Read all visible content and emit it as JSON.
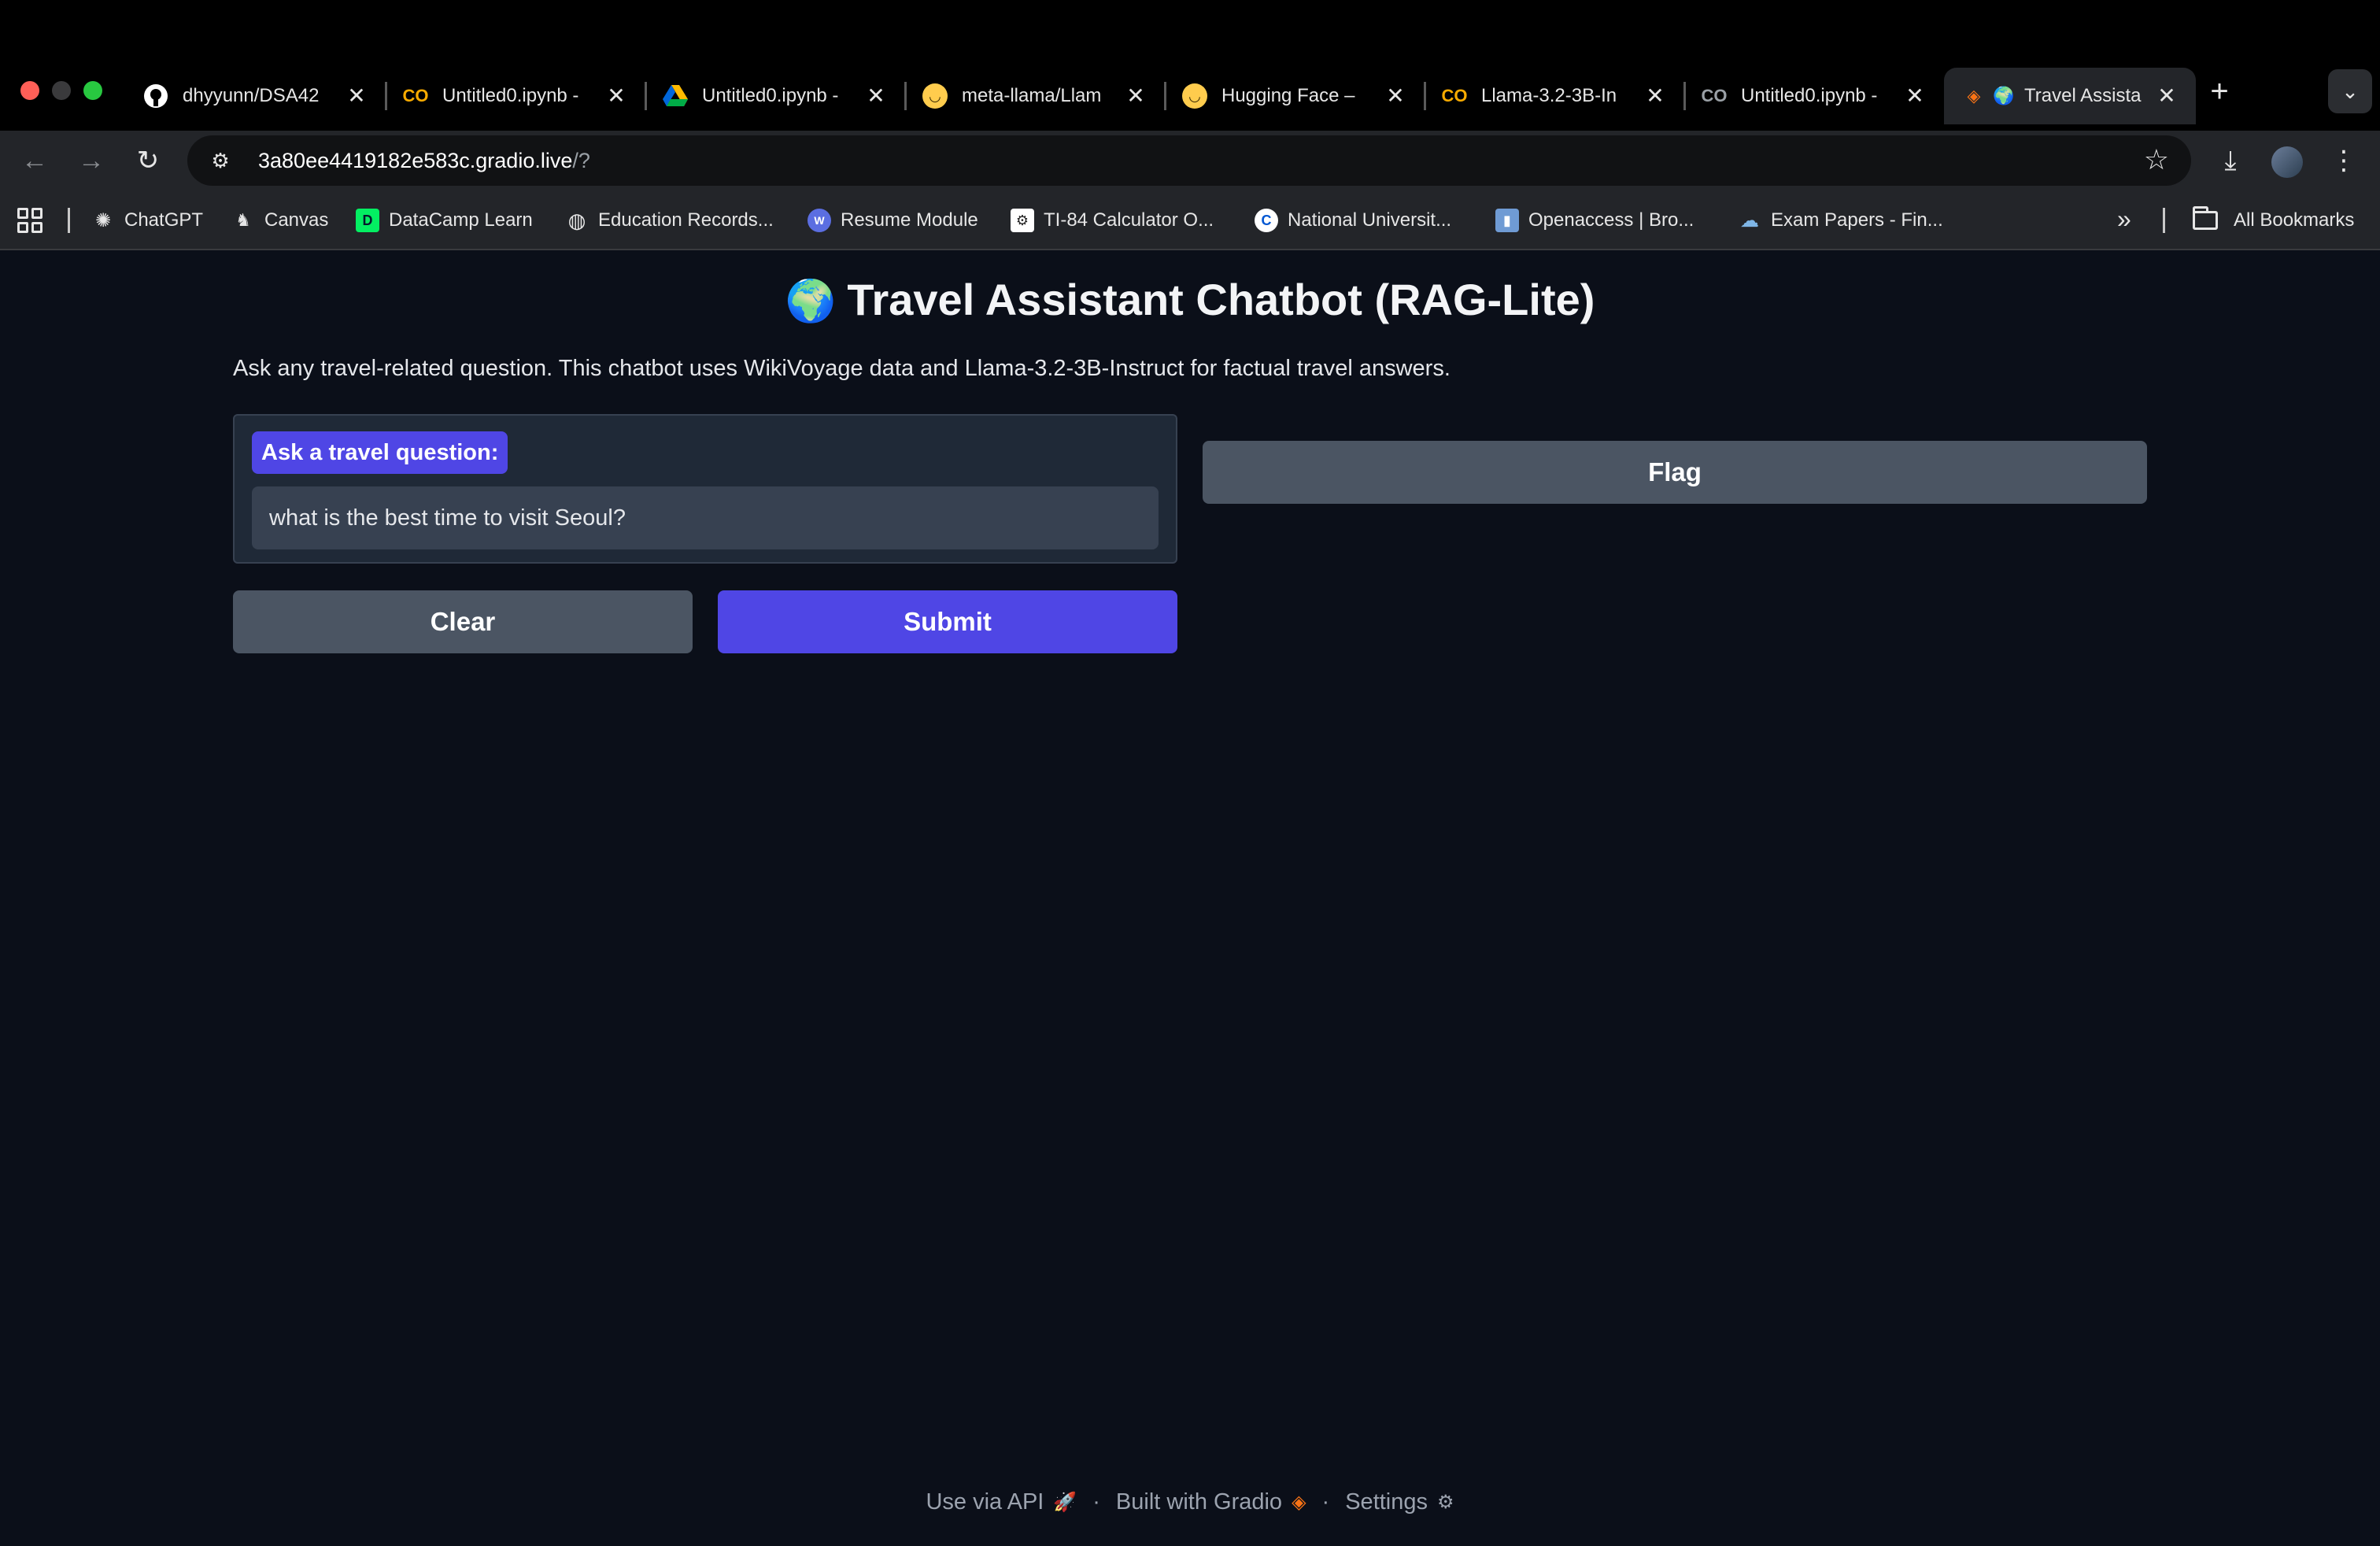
{
  "browser": {
    "tabs": [
      {
        "title": "dhyyunn/DSA42",
        "favicon": "github-icon",
        "active": false
      },
      {
        "title": "Untitled0.ipynb -",
        "favicon": "colab-icon",
        "active": false
      },
      {
        "title": "Untitled0.ipynb -",
        "favicon": "google-drive-icon",
        "active": false
      },
      {
        "title": "meta-llama/Llam",
        "favicon": "hugging-face-icon",
        "active": false
      },
      {
        "title": "Hugging Face –",
        "favicon": "hugging-face-icon",
        "active": false
      },
      {
        "title": "Llama-3.2-3B-In",
        "favicon": "colab-icon",
        "active": false
      },
      {
        "title": "Untitled0.ipynb -",
        "favicon": "colab-icon",
        "active": false
      },
      {
        "title": "Travel Assista",
        "favicon": "gradio-icon",
        "active": true
      }
    ],
    "url_host": "3a80ee4419182e583c.gradio.live",
    "url_path": "/?",
    "bookmarks": [
      {
        "label": "ChatGPT",
        "icon": "chatgpt-icon"
      },
      {
        "label": "Canvas",
        "icon": "canvas-icon"
      },
      {
        "label": "DataCamp Learn",
        "icon": "datacamp-icon"
      },
      {
        "label": "Education Records...",
        "icon": "globe-icon"
      },
      {
        "label": "Resume Module",
        "icon": "resume-icon"
      },
      {
        "label": "TI-84 Calculator O...",
        "icon": "calculator-icon"
      },
      {
        "label": "National Universit...",
        "icon": "coursera-icon"
      },
      {
        "label": "Openaccess | Bro...",
        "icon": "openaccess-icon"
      },
      {
        "label": "Exam Papers - Fin...",
        "icon": "cloud-icon"
      }
    ],
    "all_bookmarks_label": "All Bookmarks"
  },
  "app": {
    "title": "Travel Assistant Chatbot (RAG-Lite)",
    "title_emoji": "🌍",
    "description": "Ask any travel-related question. This chatbot uses WikiVoyage data and Llama-3.2-3B-Instruct for factual travel answers.",
    "input_label": "Ask a travel question:",
    "input_value": "what is the best time to visit Seoul?",
    "clear_label": "Clear",
    "submit_label": "Submit",
    "flag_label": "Flag"
  },
  "footer": {
    "api_label": "Use via API",
    "built_label": "Built with Gradio",
    "settings_label": "Settings",
    "separator": "·"
  },
  "colors": {
    "page_bg": "#0b0f19",
    "primary": "#4f46e5",
    "secondary": "#4b5563",
    "block_bg": "#1f2937"
  }
}
